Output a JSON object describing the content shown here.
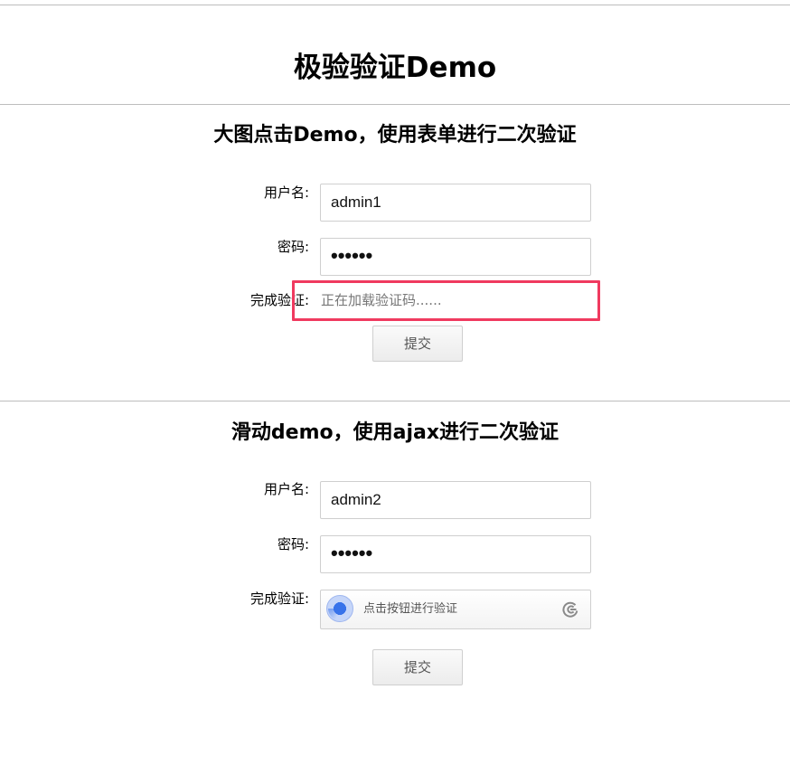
{
  "page": {
    "title": "极验验证Demo"
  },
  "section1": {
    "title": "大图点击Demo，使用表单进行二次验证",
    "username_label": "用户名:",
    "username_value": "admin1",
    "password_label": "密码:",
    "password_value": "••••••",
    "captcha_label": "完成验证:",
    "captcha_loading": "正在加载验证码......",
    "submit_label": "提交"
  },
  "section2": {
    "title": "滑动demo，使用ajax进行二次验证",
    "username_label": "用户名:",
    "username_value": "admin2",
    "password_label": "密码:",
    "password_value": "••••••",
    "captcha_label": "完成验证:",
    "captcha_prompt": "点击按钮进行验证",
    "submit_label": "提交"
  },
  "colors": {
    "loading_border": "#f03a5f",
    "radar_blue": "#3873ea",
    "divider": "#bdbdbd"
  },
  "icons": {
    "radar": "geetest-radar-icon",
    "logo": "geetest-logo-icon"
  }
}
